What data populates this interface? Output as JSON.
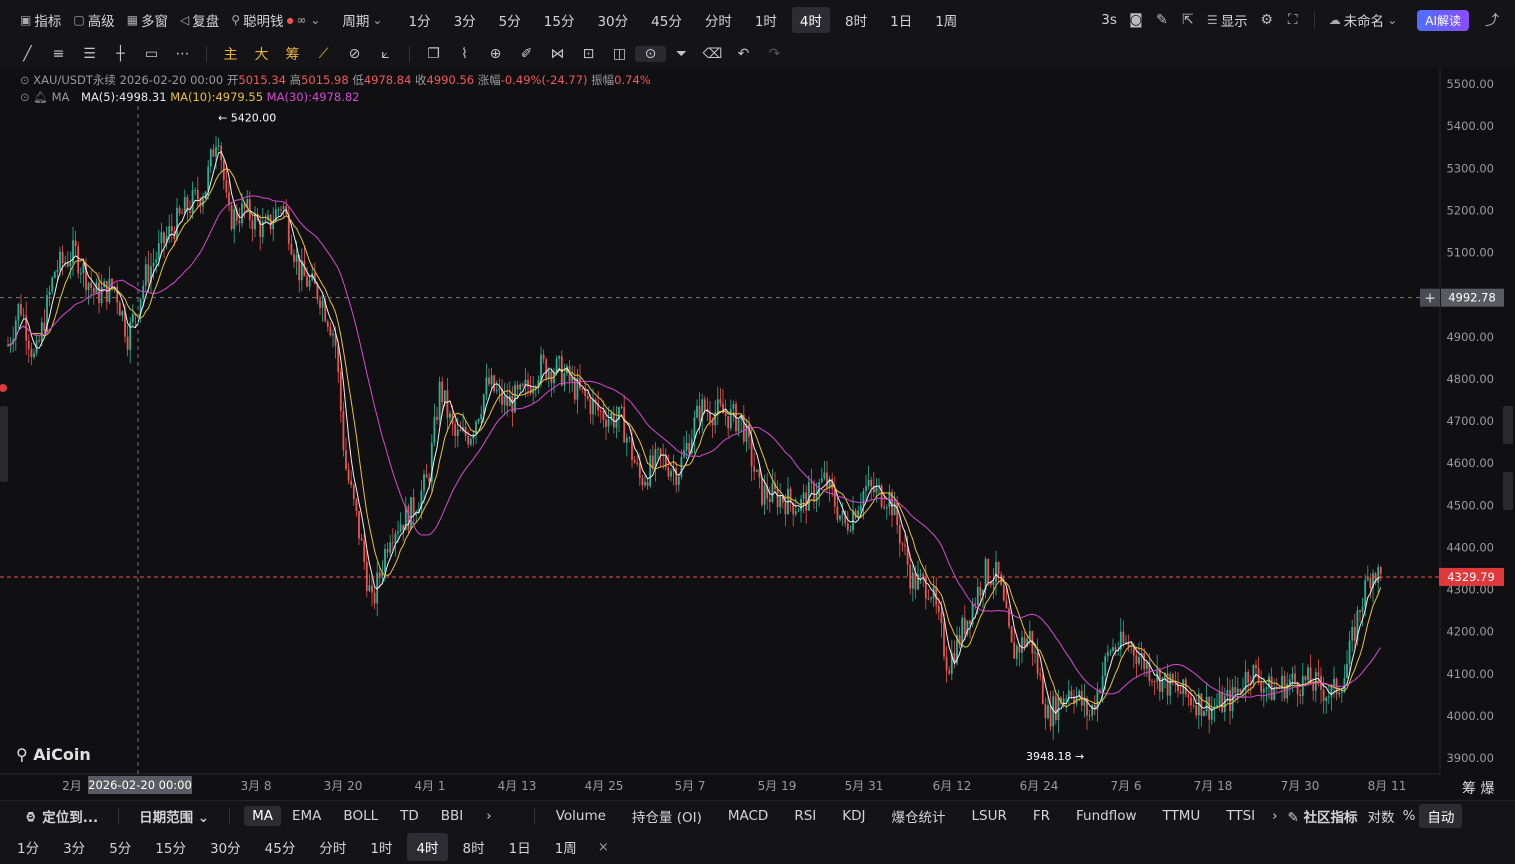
{
  "topbar": {
    "indicator": "指标",
    "advanced": "高级",
    "multi_window": "多窗",
    "replay": "复盘",
    "smart_money": "聪明钱",
    "period_label": "周期",
    "periods": [
      "1分",
      "3分",
      "5分",
      "15分",
      "30分",
      "45分",
      "分时",
      "1时",
      "4时",
      "8时",
      "1日",
      "1周"
    ],
    "active_period": "4时",
    "refresh_interval": "3s",
    "display": "显示",
    "unnamed": "未命名",
    "ai_button": "AI解读"
  },
  "info": {
    "symbol": "XAU/USDT永续",
    "date": "2026-02-20 00:00",
    "open_label": "开",
    "open": "5015.34",
    "high_label": "高",
    "high": "5015.98",
    "low_label": "低",
    "low": "4978.84",
    "close_label": "收",
    "close": "4990.56",
    "change_label": "涨幅",
    "change": "-0.49%(-24.77)",
    "amplitude_label": "振幅",
    "amplitude": "0.74%",
    "ma_name": "MA",
    "ma5": "MA(5):4998.31",
    "ma10": "MA(10):4979.55",
    "ma30": "MA(30):4978.82"
  },
  "chart_data": {
    "type": "candlestick",
    "y_ticks": [
      "5500.00",
      "5400.00",
      "5300.00",
      "5200.00",
      "5100.00",
      "5000.00",
      "4900.00",
      "4800.00",
      "4700.00",
      "4600.00",
      "4500.00",
      "4400.00",
      "4300.00",
      "4200.00",
      "4100.00",
      "4000.00",
      "3900.00"
    ],
    "ylim": [
      3880,
      5535
    ],
    "x_ticks": [
      "2月",
      "3月 8",
      "3月 20",
      "4月 1",
      "4月 13",
      "4月 25",
      "5月 7",
      "5月 19",
      "5月 31",
      "6月 12",
      "6月 24",
      "7月 6",
      "7月 18",
      "7月 30",
      "8月 11"
    ],
    "x_tick_positions": [
      72,
      256,
      343,
      430,
      517,
      604,
      690,
      777,
      864,
      952,
      1039,
      1126,
      1213,
      1300,
      1387
    ],
    "crosshair_date": "2026-02-20 00:00",
    "crosshair_price": "4992.78",
    "last_price": "4329.79",
    "max_label": "5420.00",
    "min_label": "3948.18",
    "trend": [
      [
        8,
        4880
      ],
      [
        20,
        4980
      ],
      [
        35,
        4840
      ],
      [
        55,
        5060
      ],
      [
        75,
        5100
      ],
      [
        95,
        5000
      ],
      [
        115,
        5020
      ],
      [
        128,
        4900
      ],
      [
        145,
        5040
      ],
      [
        165,
        5130
      ],
      [
        185,
        5200
      ],
      [
        205,
        5250
      ],
      [
        218,
        5400
      ],
      [
        228,
        5180
      ],
      [
        245,
        5200
      ],
      [
        265,
        5150
      ],
      [
        282,
        5220
      ],
      [
        300,
        5050
      ],
      [
        320,
        5000
      ],
      [
        335,
        4900
      ],
      [
        345,
        4600
      ],
      [
        358,
        4450
      ],
      [
        372,
        4260
      ],
      [
        390,
        4440
      ],
      [
        410,
        4480
      ],
      [
        428,
        4560
      ],
      [
        440,
        4780
      ],
      [
        455,
        4660
      ],
      [
        470,
        4670
      ],
      [
        488,
        4790
      ],
      [
        505,
        4740
      ],
      [
        522,
        4760
      ],
      [
        540,
        4830
      ],
      [
        560,
        4820
      ],
      [
        578,
        4770
      ],
      [
        600,
        4720
      ],
      [
        622,
        4700
      ],
      [
        640,
        4560
      ],
      [
        660,
        4610
      ],
      [
        678,
        4580
      ],
      [
        700,
        4730
      ],
      [
        720,
        4720
      ],
      [
        742,
        4700
      ],
      [
        760,
        4530
      ],
      [
        778,
        4520
      ],
      [
        800,
        4500
      ],
      [
        825,
        4560
      ],
      [
        845,
        4450
      ],
      [
        865,
        4540
      ],
      [
        890,
        4520
      ],
      [
        912,
        4320
      ],
      [
        930,
        4310
      ],
      [
        948,
        4120
      ],
      [
        965,
        4220
      ],
      [
        985,
        4340
      ],
      [
        998,
        4330
      ],
      [
        1012,
        4150
      ],
      [
        1030,
        4190
      ],
      [
        1048,
        4000
      ],
      [
        1070,
        4070
      ],
      [
        1090,
        4000
      ],
      [
        1110,
        4160
      ],
      [
        1130,
        4170
      ],
      [
        1150,
        4110
      ],
      [
        1170,
        4070
      ],
      [
        1192,
        4040
      ],
      [
        1212,
        4020
      ],
      [
        1232,
        4040
      ],
      [
        1250,
        4110
      ],
      [
        1270,
        4060
      ],
      [
        1290,
        4080
      ],
      [
        1310,
        4080
      ],
      [
        1332,
        4050
      ],
      [
        1345,
        4100
      ],
      [
        1360,
        4260
      ],
      [
        1372,
        4350
      ],
      [
        1383,
        4320
      ]
    ]
  },
  "bottom1": {
    "locate": "定位到...",
    "date_range": "日期范围",
    "indicators": [
      "MA",
      "EMA",
      "BOLL",
      "TD",
      "BBI"
    ],
    "sub_indicators": [
      "Volume",
      "持仓量 (OI)",
      "MACD",
      "RSI",
      "KDJ",
      "爆仓统计",
      "LSUR",
      "FR",
      "Fundflow",
      "TTMU",
      "TTSI"
    ],
    "community": "社区指标",
    "log": "对数",
    "percent": "%",
    "auto": "自动"
  },
  "bottom2": {
    "periods": [
      "1分",
      "3分",
      "5分",
      "15分",
      "30分",
      "45分",
      "分时",
      "1时",
      "4时",
      "8时",
      "1日",
      "1周"
    ],
    "active": "4时"
  },
  "right_side": {
    "chips": "筹",
    "blast": "爆"
  },
  "colors": {
    "up": "#26b59a",
    "down": "#ef5350",
    "ma5": "#f1f1f1",
    "ma10": "#e7c23a",
    "ma30": "#d44bd1",
    "bg": "#101012",
    "last_price_bg": "#e0393b"
  }
}
